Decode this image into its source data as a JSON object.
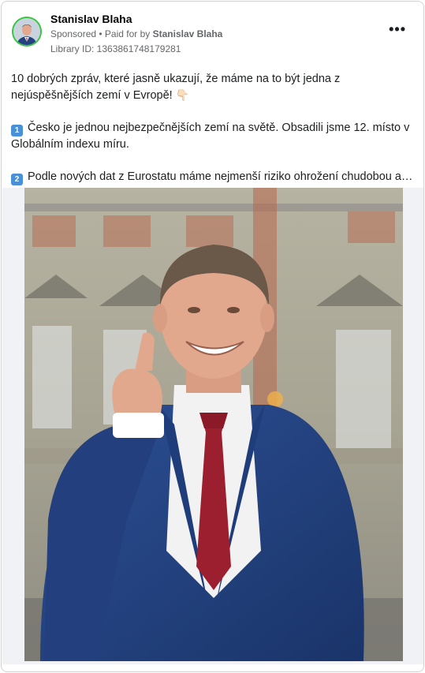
{
  "post": {
    "author": "Stanislav Blaha",
    "sponsored": "Sponsored",
    "paid_for_prefix": " • Paid for by ",
    "paid_for_name": "Stanislav Blaha",
    "library_id": "Library ID: 1363861748179281",
    "more_icon": "more-horizontal-icon",
    "text": {
      "intro": "10 dobrých zpráv, které jasně ukazují, že máme na to být jedna z nejúspěšnějších zemí v Evropě!",
      "point_icon": "👇🏻",
      "item1_key": "1",
      "item1_text": "Česko je jednou nejbezpečnějších zemí na světě. Obsadili jsme 12. místo v Globálním indexu míru.",
      "item2_key": "2",
      "item2_text": "Podle nových dat z Eurostatu máme nejmenší riziko ohrožení chudobou a…"
    }
  },
  "colors": {
    "avatar_ring": "#36c53e",
    "suit": "#1f3f7d",
    "tie": "#9b1f2e",
    "keycap": "#4a90d9"
  }
}
